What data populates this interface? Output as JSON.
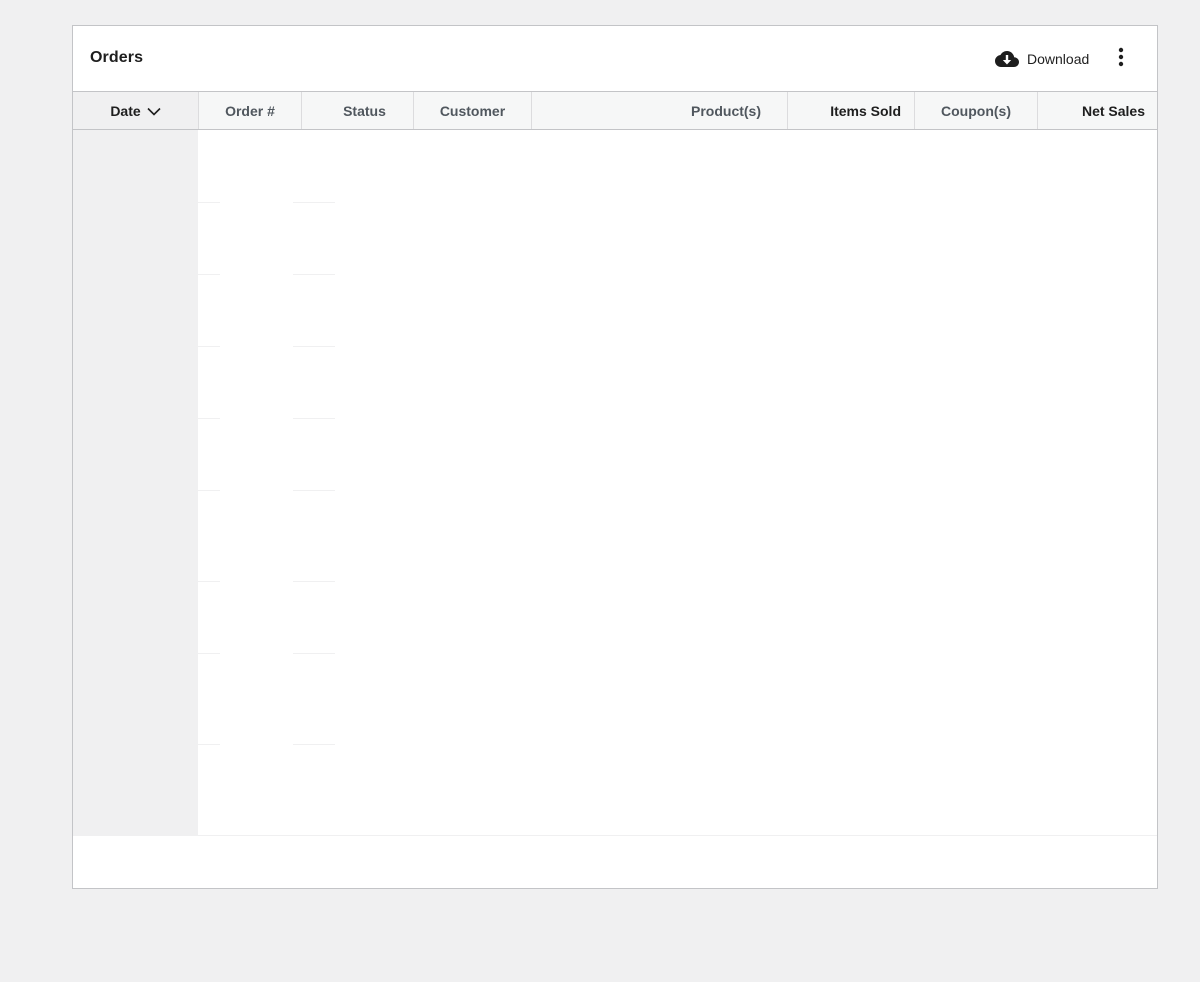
{
  "card": {
    "title": "Orders",
    "download_label": "Download",
    "download_icon": "cloud-download-icon",
    "more_icon": "vertical-ellipsis-icon"
  },
  "table": {
    "columns": [
      {
        "key": "date",
        "label": "Date",
        "sorted": true,
        "sort_icon": "chevron-down-icon"
      },
      {
        "key": "order_number",
        "label": "Order #"
      },
      {
        "key": "status",
        "label": "Status"
      },
      {
        "key": "customer",
        "label": "Customer"
      },
      {
        "key": "products",
        "label": "Product(s)"
      },
      {
        "key": "items_sold",
        "label": "Items Sold"
      },
      {
        "key": "coupons",
        "label": "Coupon(s)"
      },
      {
        "key": "net_sales",
        "label": "Net Sales"
      }
    ],
    "rows": []
  },
  "colors": {
    "page_background": "#f0f0f1",
    "card_border": "#c3c4c7",
    "header_background": "#f6f7f7",
    "text_primary": "#1e1e1e",
    "text_muted": "#50575e"
  }
}
